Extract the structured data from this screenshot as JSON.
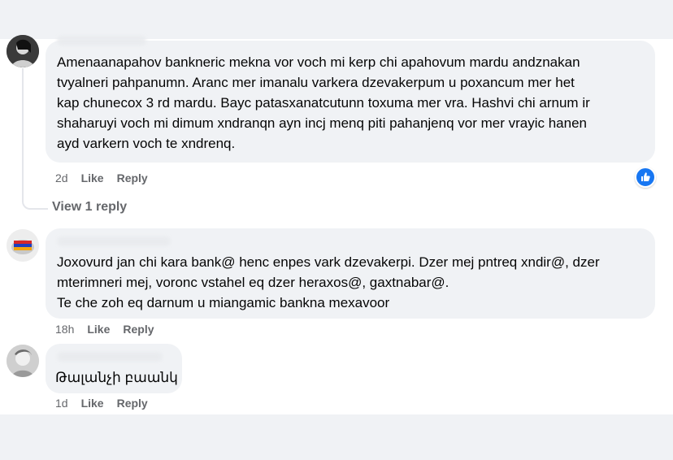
{
  "comments": [
    {
      "text_lines": [
        "Amenaanapahov bankneric mekna vor voch mi kerp chi apahovum mardu andznakan",
        "tvyalneri pahpanumn. Aranc mer imanalu varkera dzevakerpum u poxancum mer het",
        "kap chunecox 3 rd mardu. Bayc patasxanatcutunn toxuma mer vra. Hashvi chi arnum ir",
        "shaharuyi voch mi dimum xndranqn ayn incj menq piti pahanjenq vor mer vrayic hanen",
        "ayd varkern voch te xndrenq."
      ],
      "time": "2d",
      "like_label": "Like",
      "reply_label": "Reply",
      "reaction_icon": "like-reaction-icon",
      "view_replies": "View 1 reply"
    },
    {
      "text_lines": [
        "Joxovurd jan chi kara bank@ henc enpes vark dzevakerpi. Dzer mej pntreq xndir@, dzer",
        "mterimneri mej, voronc vstahel eq dzer heraxos@, gaxtnabar@.",
        "Te che zoh eq darnum u miangamic bankna mexavoor"
      ],
      "time": "18h",
      "like_label": "Like",
      "reply_label": "Reply"
    },
    {
      "text_lines": [
        "Թալանչի բաանկ"
      ],
      "time": "1d",
      "like_label": "Like",
      "reply_label": "Reply"
    }
  ],
  "colors": {
    "bubble": "#f0f2f5",
    "meta_text": "#65676b",
    "accent": "#1877f2"
  }
}
